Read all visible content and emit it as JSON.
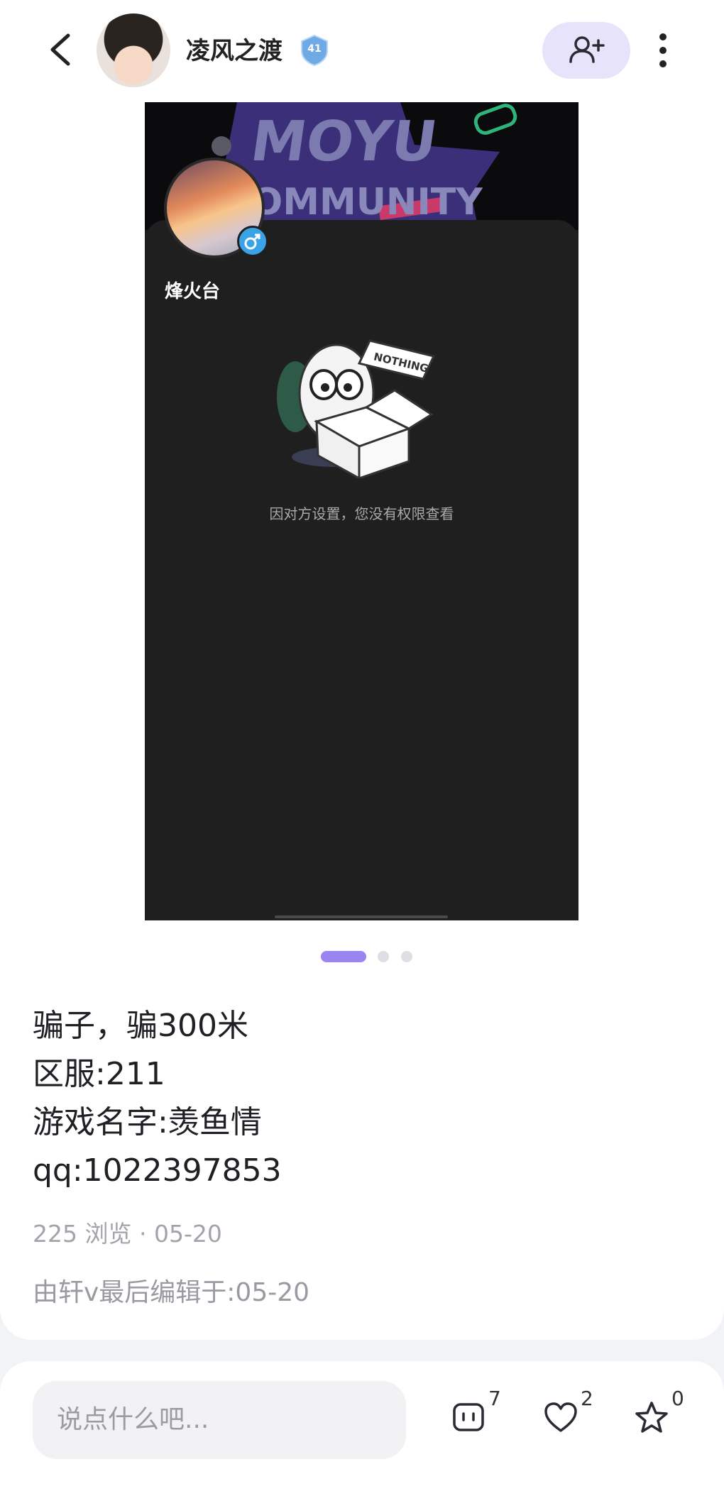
{
  "header": {
    "username": "凌风之渡",
    "level": "41"
  },
  "screenshot": {
    "banner_text_1": "MOYU",
    "banner_text_2": "OMMUNITY",
    "profile_name": "烽火台",
    "nothing_label": "NOTHING",
    "message": "因对方设置，您没有权限查看"
  },
  "pager": {
    "count": 3,
    "active_index": 0
  },
  "post": {
    "lines": [
      "骗子，骗300米",
      "区服:211",
      "游戏名字:羡鱼情",
      "qq:1022397853"
    ],
    "views": "225 浏览",
    "date": "05-20",
    "edit_note": "由轩v最后编辑于:05-20"
  },
  "bottom_bar": {
    "comment_placeholder": "说点什么吧...",
    "comment_count": "7",
    "like_count": "2",
    "favorite_count": "0"
  },
  "colors": {
    "accent": "#9a85f0",
    "follow_bg": "#e7e3fb",
    "dark_panel": "#1f1f20"
  }
}
